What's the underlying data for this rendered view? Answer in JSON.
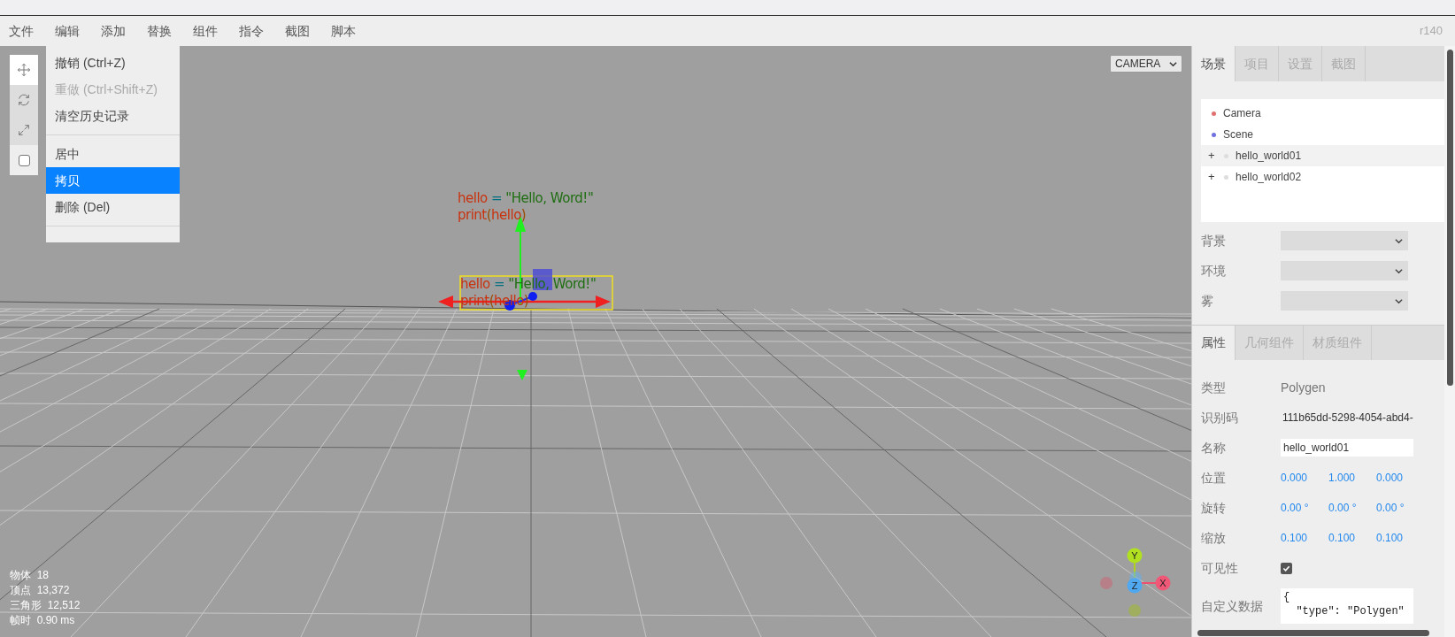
{
  "menubar": {
    "menus": [
      "文件",
      "编辑",
      "添加",
      "替换",
      "组件",
      "指令",
      "截图",
      "脚本"
    ],
    "version": "r140"
  },
  "edit_menu": {
    "items": [
      {
        "kind": "item",
        "label": "撤销 (Ctrl+Z)",
        "disabled": false,
        "selected": false
      },
      {
        "kind": "item",
        "label": "重做 (Ctrl+Shift+Z)",
        "disabled": true,
        "selected": false
      },
      {
        "kind": "item",
        "label": "清空历史记录",
        "disabled": false,
        "selected": false
      },
      {
        "kind": "separator"
      },
      {
        "kind": "item",
        "label": "居中",
        "disabled": false,
        "selected": false
      },
      {
        "kind": "item",
        "label": "拷贝",
        "disabled": false,
        "selected": true
      },
      {
        "kind": "item",
        "label": "删除 (Del)",
        "disabled": false,
        "selected": false
      },
      {
        "kind": "separator"
      }
    ]
  },
  "toolbar": {
    "tools": [
      {
        "kind": "move",
        "selected": true
      },
      {
        "kind": "rotate",
        "selected": false
      },
      {
        "kind": "scale",
        "selected": false
      }
    ],
    "local": {
      "checked": false
    }
  },
  "viewport": {
    "camera_select": "CAMERA",
    "texts": [
      {
        "lines": [
          [
            {
              "kind": "variable",
              "text": "hello"
            },
            {
              "kind": "operator",
              "text": " = "
            },
            {
              "kind": "string",
              "text": "\"Hello, Word!\""
            }
          ],
          [
            {
              "kind": "variable",
              "text": "print"
            },
            {
              "kind": "paren",
              "text": "("
            },
            {
              "kind": "variable",
              "text": "hello"
            },
            {
              "kind": "paren",
              "text": ")"
            }
          ]
        ]
      },
      {
        "lines": [
          [
            {
              "kind": "variable",
              "text": "hello"
            },
            {
              "kind": "operator",
              "text": " = "
            },
            {
              "kind": "string",
              "text": "\"Hello, Word!\""
            }
          ],
          [
            {
              "kind": "variable",
              "text": "print"
            },
            {
              "kind": "paren",
              "text": "("
            },
            {
              "kind": "variable",
              "text": "hello"
            },
            {
              "kind": "paren",
              "text": ")"
            }
          ]
        ]
      }
    ],
    "axis_helper": {
      "labels": [
        "Y",
        "Z",
        "X"
      ]
    },
    "stats": [
      {
        "label": "物体",
        "value": "18"
      },
      {
        "label": "顶点",
        "value": "13,372"
      },
      {
        "label": "三角形",
        "value": "12,512"
      },
      {
        "label": "帧时",
        "value": "0.90 ms"
      }
    ]
  },
  "sidebar": {
    "tabs": [
      {
        "label": "场景",
        "selected": true
      },
      {
        "label": "项目",
        "selected": false
      },
      {
        "label": "设置",
        "selected": false
      },
      {
        "label": "截图",
        "selected": false
      }
    ],
    "outliner": [
      {
        "label": "Camera",
        "color": "#e07070",
        "selected": false
      },
      {
        "label": "Scene",
        "color": "#7070e0",
        "selected": false
      },
      {
        "label": "hello_world01",
        "color": "#dddddd",
        "opener": "+",
        "selected": true
      },
      {
        "label": "hello_world02",
        "color": "#dddddd",
        "opener": "+",
        "selected": false
      }
    ],
    "scene_settings": [
      {
        "label": "背景"
      },
      {
        "label": "环境"
      },
      {
        "label": "雾"
      }
    ],
    "properties_tabs": [
      {
        "label": "属性",
        "selected": true
      },
      {
        "label": "几何组件",
        "selected": false
      },
      {
        "label": "材质组件",
        "selected": false
      }
    ],
    "properties": [
      {
        "kind": "text",
        "label": "类型",
        "value": "Polygen"
      },
      {
        "kind": "uuid",
        "label": "识别码",
        "value": "111b65dd-5298-4054-abd4-"
      },
      {
        "kind": "input",
        "label": "名称",
        "value": "hello_world01"
      },
      {
        "kind": "vector",
        "label": "位置",
        "values": [
          "0.000",
          "1.000",
          "0.000"
        ]
      },
      {
        "kind": "vector",
        "label": "旋转",
        "values": [
          "0.00 °",
          "0.00 °",
          "0.00 °"
        ]
      },
      {
        "kind": "vector",
        "label": "缩放",
        "values": [
          "0.100",
          "0.100",
          "0.100"
        ]
      },
      {
        "kind": "checkbox",
        "label": "可见性",
        "checked": true
      },
      {
        "kind": "textarea",
        "label": "自定义数据",
        "lines": [
          "{",
          "  \"type\": \"Polygen\""
        ]
      }
    ]
  }
}
